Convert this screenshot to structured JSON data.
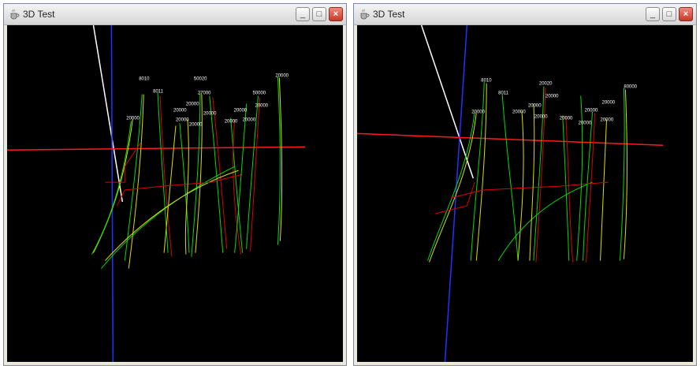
{
  "windows": [
    {
      "title": "3D Test",
      "labels": [
        "8010",
        "50020",
        "8011",
        "27000",
        "20000",
        "50000",
        "20000",
        "20000",
        "20000",
        "20000",
        "20000",
        "20000",
        "20000",
        "20000",
        "20000",
        "20000"
      ]
    },
    {
      "title": "3D Test",
      "labels": [
        "8010",
        "20020",
        "8011",
        "20000",
        "80000",
        "20000",
        "20000",
        "20000",
        "20000",
        "20000",
        "20000",
        "20000",
        "20000",
        "20000"
      ]
    }
  ],
  "controls": {
    "minimize": "_",
    "maximize": "□",
    "close": "×"
  },
  "colors": {
    "background": "#000000",
    "axis_x": "#ff0000",
    "axis_y": "#0000ff",
    "axis_z": "#ffffff",
    "track_a": "#00dd00",
    "track_b": "#dddd00",
    "track_c": "#dd0000"
  },
  "icons": [
    "java-coffee-icon"
  ]
}
